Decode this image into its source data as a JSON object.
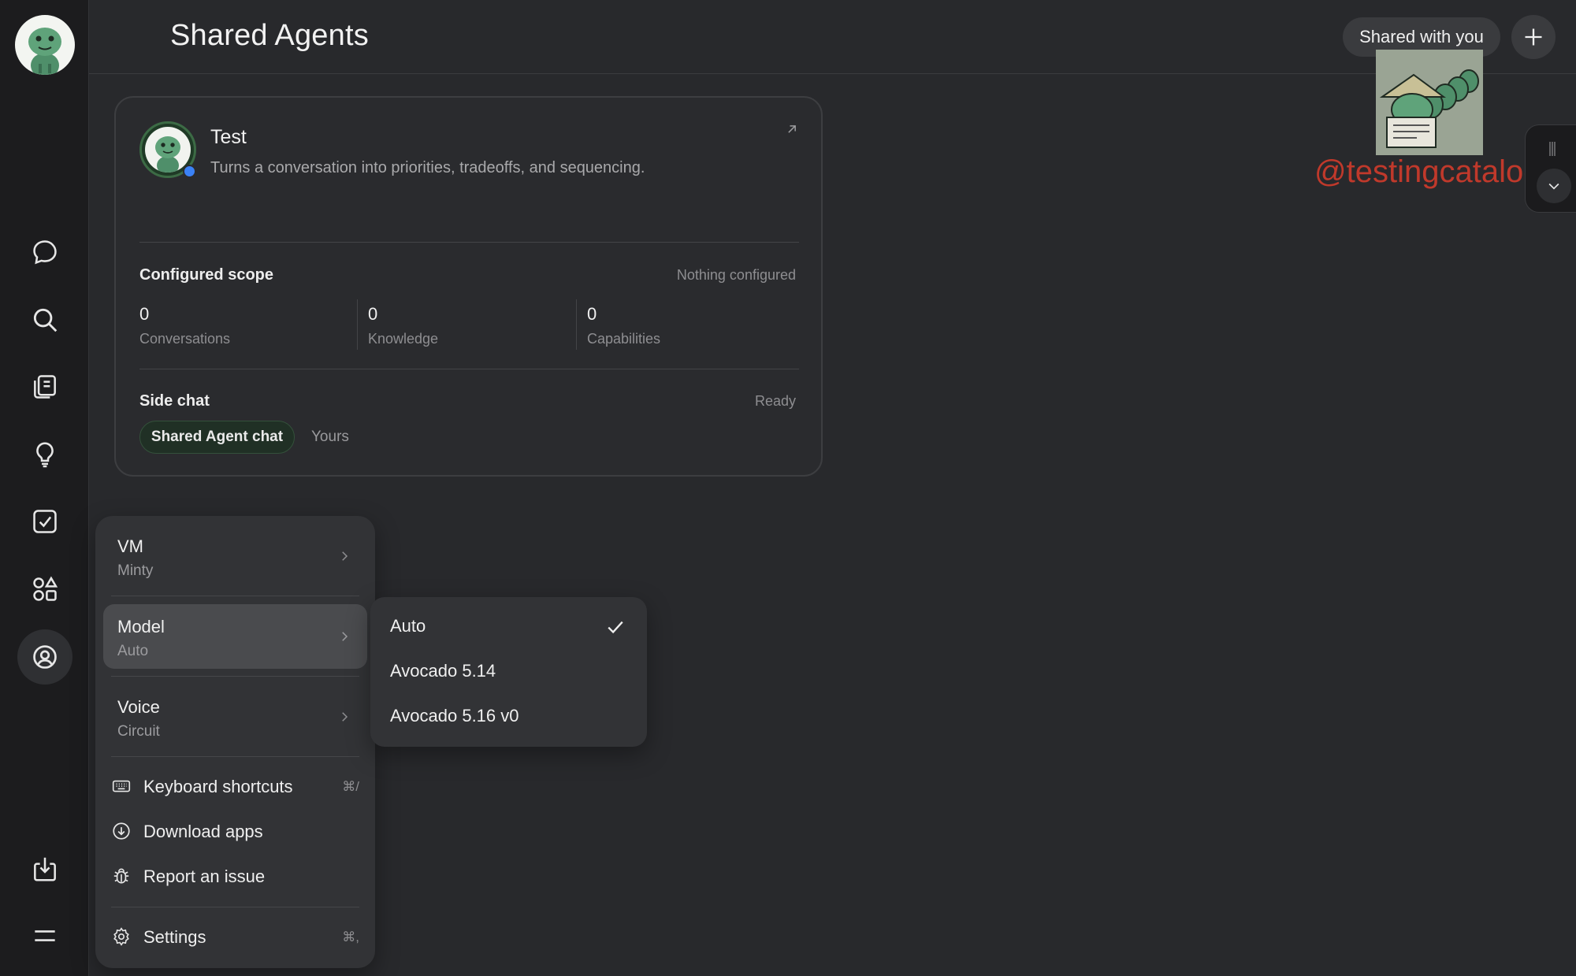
{
  "header": {
    "title": "Shared Agents",
    "filter_pill": "Shared with you"
  },
  "sidebar": {
    "items": [
      {
        "icon": "chat-bubble-icon"
      },
      {
        "icon": "search-icon"
      },
      {
        "icon": "library-icon"
      },
      {
        "icon": "lightbulb-icon"
      },
      {
        "icon": "tasks-checkbox-icon"
      },
      {
        "icon": "apps-shapes-icon"
      },
      {
        "icon": "agent-icon",
        "active": true
      },
      {
        "icon": "download-icon"
      },
      {
        "icon": "menu-icon"
      }
    ]
  },
  "agent_card": {
    "name": "Test",
    "description": "Turns a conversation into priorities, tradeoffs, and sequencing.",
    "scope": {
      "title": "Configured scope",
      "status": "Nothing configured",
      "stats": [
        {
          "value": "0",
          "label": "Conversations"
        },
        {
          "value": "0",
          "label": "Knowledge"
        },
        {
          "value": "0",
          "label": "Capabilities"
        }
      ]
    },
    "side_chat": {
      "title": "Side chat",
      "status": "Ready",
      "chip": "Shared Agent chat",
      "owner": "Yours"
    }
  },
  "menu": {
    "vm": {
      "label": "VM",
      "value": "Minty"
    },
    "model": {
      "label": "Model",
      "value": "Auto"
    },
    "voice": {
      "label": "Voice",
      "value": "Circuit"
    },
    "keyboard": {
      "label": "Keyboard shortcuts",
      "shortcut": "⌘/"
    },
    "download": {
      "label": "Download apps"
    },
    "report": {
      "label": "Report an issue"
    },
    "settings": {
      "label": "Settings",
      "shortcut": "⌘,"
    }
  },
  "model_submenu": {
    "options": [
      "Auto",
      "Avocado 5.14",
      "Avocado 5.16 v0"
    ],
    "selected": "Auto"
  },
  "overlay": {
    "watermark": "@testingcatalog"
  },
  "colors": {
    "background": "#28292c",
    "rail": "#1c1c1e",
    "status_dot": "#3b82f6",
    "chip_bg": "#203025",
    "watermark": "#c0392b"
  }
}
